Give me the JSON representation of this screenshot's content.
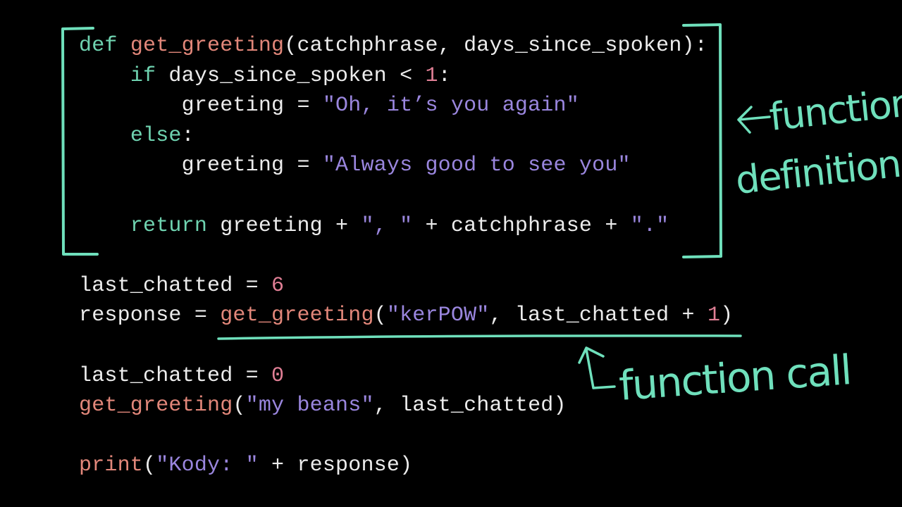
{
  "colors": {
    "background": "#000000",
    "keyword": "#6fd3b0",
    "function_name": "#e2877a",
    "string": "#9a86de",
    "number": "#e07f95",
    "default": "#ececec",
    "annotation": "#6fe0bc"
  },
  "code": {
    "lines": [
      [
        {
          "t": "kw",
          "v": "def "
        },
        {
          "t": "fn",
          "v": "get_greeting"
        },
        {
          "t": "plain",
          "v": "(catchphrase, days_since_spoken):"
        }
      ],
      [
        {
          "t": "plain",
          "v": "    "
        },
        {
          "t": "kw",
          "v": "if"
        },
        {
          "t": "plain",
          "v": " days_since_spoken < "
        },
        {
          "t": "num",
          "v": "1"
        },
        {
          "t": "plain",
          "v": ":"
        }
      ],
      [
        {
          "t": "plain",
          "v": "        greeting = "
        },
        {
          "t": "str",
          "v": "\"Oh, it’s you again\""
        }
      ],
      [
        {
          "t": "plain",
          "v": "    "
        },
        {
          "t": "kw",
          "v": "else"
        },
        {
          "t": "plain",
          "v": ":"
        }
      ],
      [
        {
          "t": "plain",
          "v": "        greeting = "
        },
        {
          "t": "str",
          "v": "\"Always good to see you\""
        }
      ],
      [],
      [
        {
          "t": "plain",
          "v": "    "
        },
        {
          "t": "kw",
          "v": "return"
        },
        {
          "t": "plain",
          "v": " greeting + "
        },
        {
          "t": "str",
          "v": "\", \""
        },
        {
          "t": "plain",
          "v": " + catchphrase + "
        },
        {
          "t": "str",
          "v": "\".\""
        }
      ],
      [],
      [
        {
          "t": "plain",
          "v": "last_chatted = "
        },
        {
          "t": "num",
          "v": "6"
        }
      ],
      [
        {
          "t": "plain",
          "v": "response = "
        },
        {
          "t": "fn",
          "v": "get_greeting"
        },
        {
          "t": "plain",
          "v": "("
        },
        {
          "t": "str",
          "v": "\"kerPOW\""
        },
        {
          "t": "plain",
          "v": ", last_chatted + "
        },
        {
          "t": "num",
          "v": "1"
        },
        {
          "t": "plain",
          "v": ")"
        }
      ],
      [],
      [
        {
          "t": "plain",
          "v": "last_chatted = "
        },
        {
          "t": "num",
          "v": "0"
        }
      ],
      [
        {
          "t": "fn",
          "v": "get_greeting"
        },
        {
          "t": "plain",
          "v": "("
        },
        {
          "t": "str",
          "v": "\"my beans\""
        },
        {
          "t": "plain",
          "v": ", last_chatted)"
        }
      ],
      [],
      [
        {
          "t": "fn",
          "v": "print"
        },
        {
          "t": "plain",
          "v": "("
        },
        {
          "t": "str",
          "v": "\"Kody: \""
        },
        {
          "t": "plain",
          "v": " + response)"
        }
      ]
    ]
  },
  "annotations": {
    "definition_line1": "function",
    "definition_line2": "definition",
    "call_label": "function call",
    "left_arrow": "left-arrow",
    "up_arrow": "up-arrow"
  }
}
